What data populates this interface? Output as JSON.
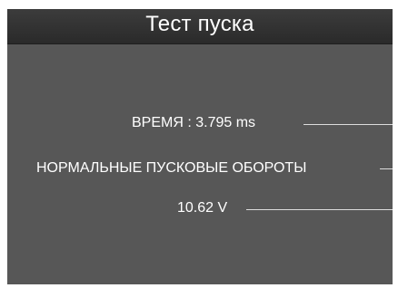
{
  "app": {
    "title": "Тест пуска"
  },
  "readings": {
    "time": "ВРЕМЯ : 3.795 ms",
    "rpm_status": "НОРМАЛЬНЫЕ ПУСКОВЫЕ ОБОРОТЫ",
    "voltage": "10.62 V"
  },
  "colors": {
    "panel_background": "#575757",
    "title_bar": "#2f2f2f",
    "text": "#ffffff"
  }
}
